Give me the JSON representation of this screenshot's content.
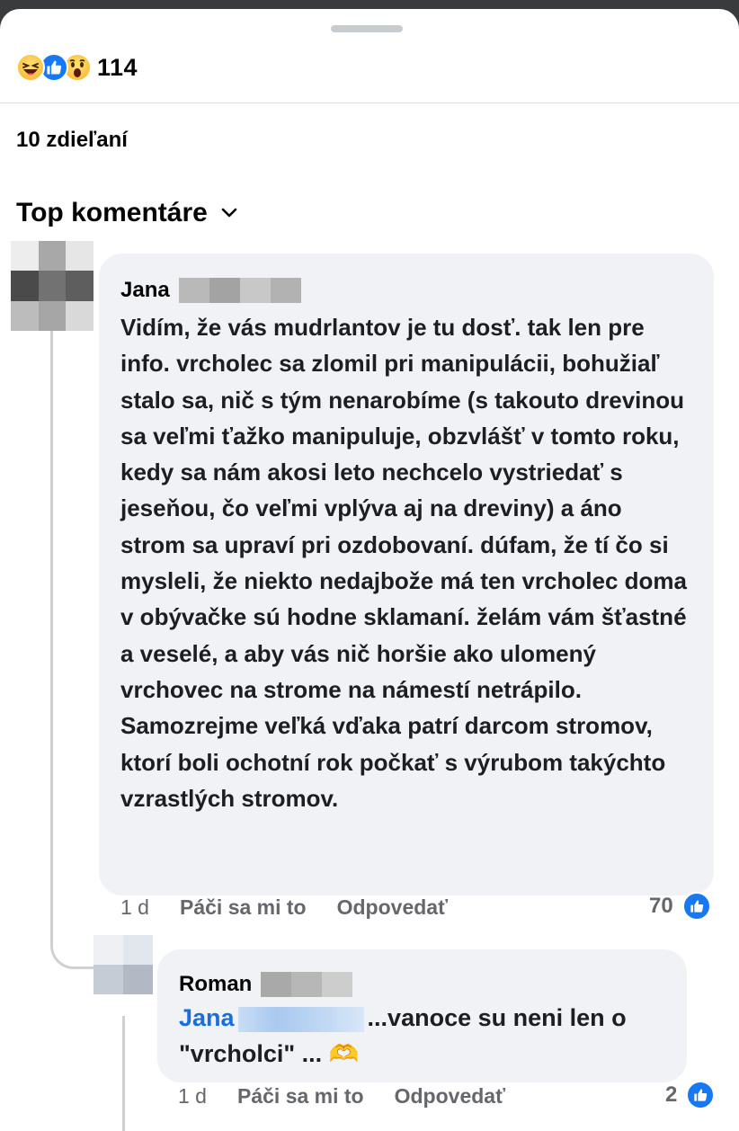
{
  "post": {
    "reaction_icons": [
      "haha-icon",
      "like-icon",
      "wow-icon"
    ],
    "reaction_count": "114",
    "shares": "10 zdieľaní",
    "comments_filter": "Top komentáre"
  },
  "comments": [
    {
      "author": "Jana",
      "text": "Vidím, že vás mudrlantov je tu dosť. tak len pre info. vrcholec sa zlomil pri manipulácii, bohužiaľ stalo sa, nič s tým nenarobíme (s takouto drevinou sa veľmi ťažko manipuluje, obzvlášť v tomto roku, kedy sa nám akosi leto nechcelo vystriedať s jeseňou, čo veľmi vplýva aj na dreviny) a áno strom sa upraví pri ozdobovaní. dúfam, že tí čo si mysleli, že niekto nedajbože má ten vrcholec doma v obývačke sú hodne sklamaní. želám vám šťastné a veselé, a aby vás nič horšie ako ulomený vrchovec na strome na námestí netrápilo.   Samozrejme veľká vďaka patrí darcom stromov, ktorí boli ochotní rok počkať s výrubom takýchto vzrastlých stromov.",
      "time": "1 d",
      "like_label": "Páči sa mi to",
      "reply_label": "Odpovedať",
      "likes": "70"
    },
    {
      "author": "Roman",
      "mention": "Jana",
      "text": "...vanoce su neni len o \"vrcholci\" ... 🫶",
      "time": "1 d",
      "like_label": "Páči sa mi to",
      "reply_label": "Odpovedať",
      "likes": "2"
    }
  ],
  "colors": {
    "link_blue": "#1a6ed8",
    "like_blue": "#1877f2",
    "bubble_bg": "#f0f2f5",
    "meta_gray": "#65676b"
  }
}
